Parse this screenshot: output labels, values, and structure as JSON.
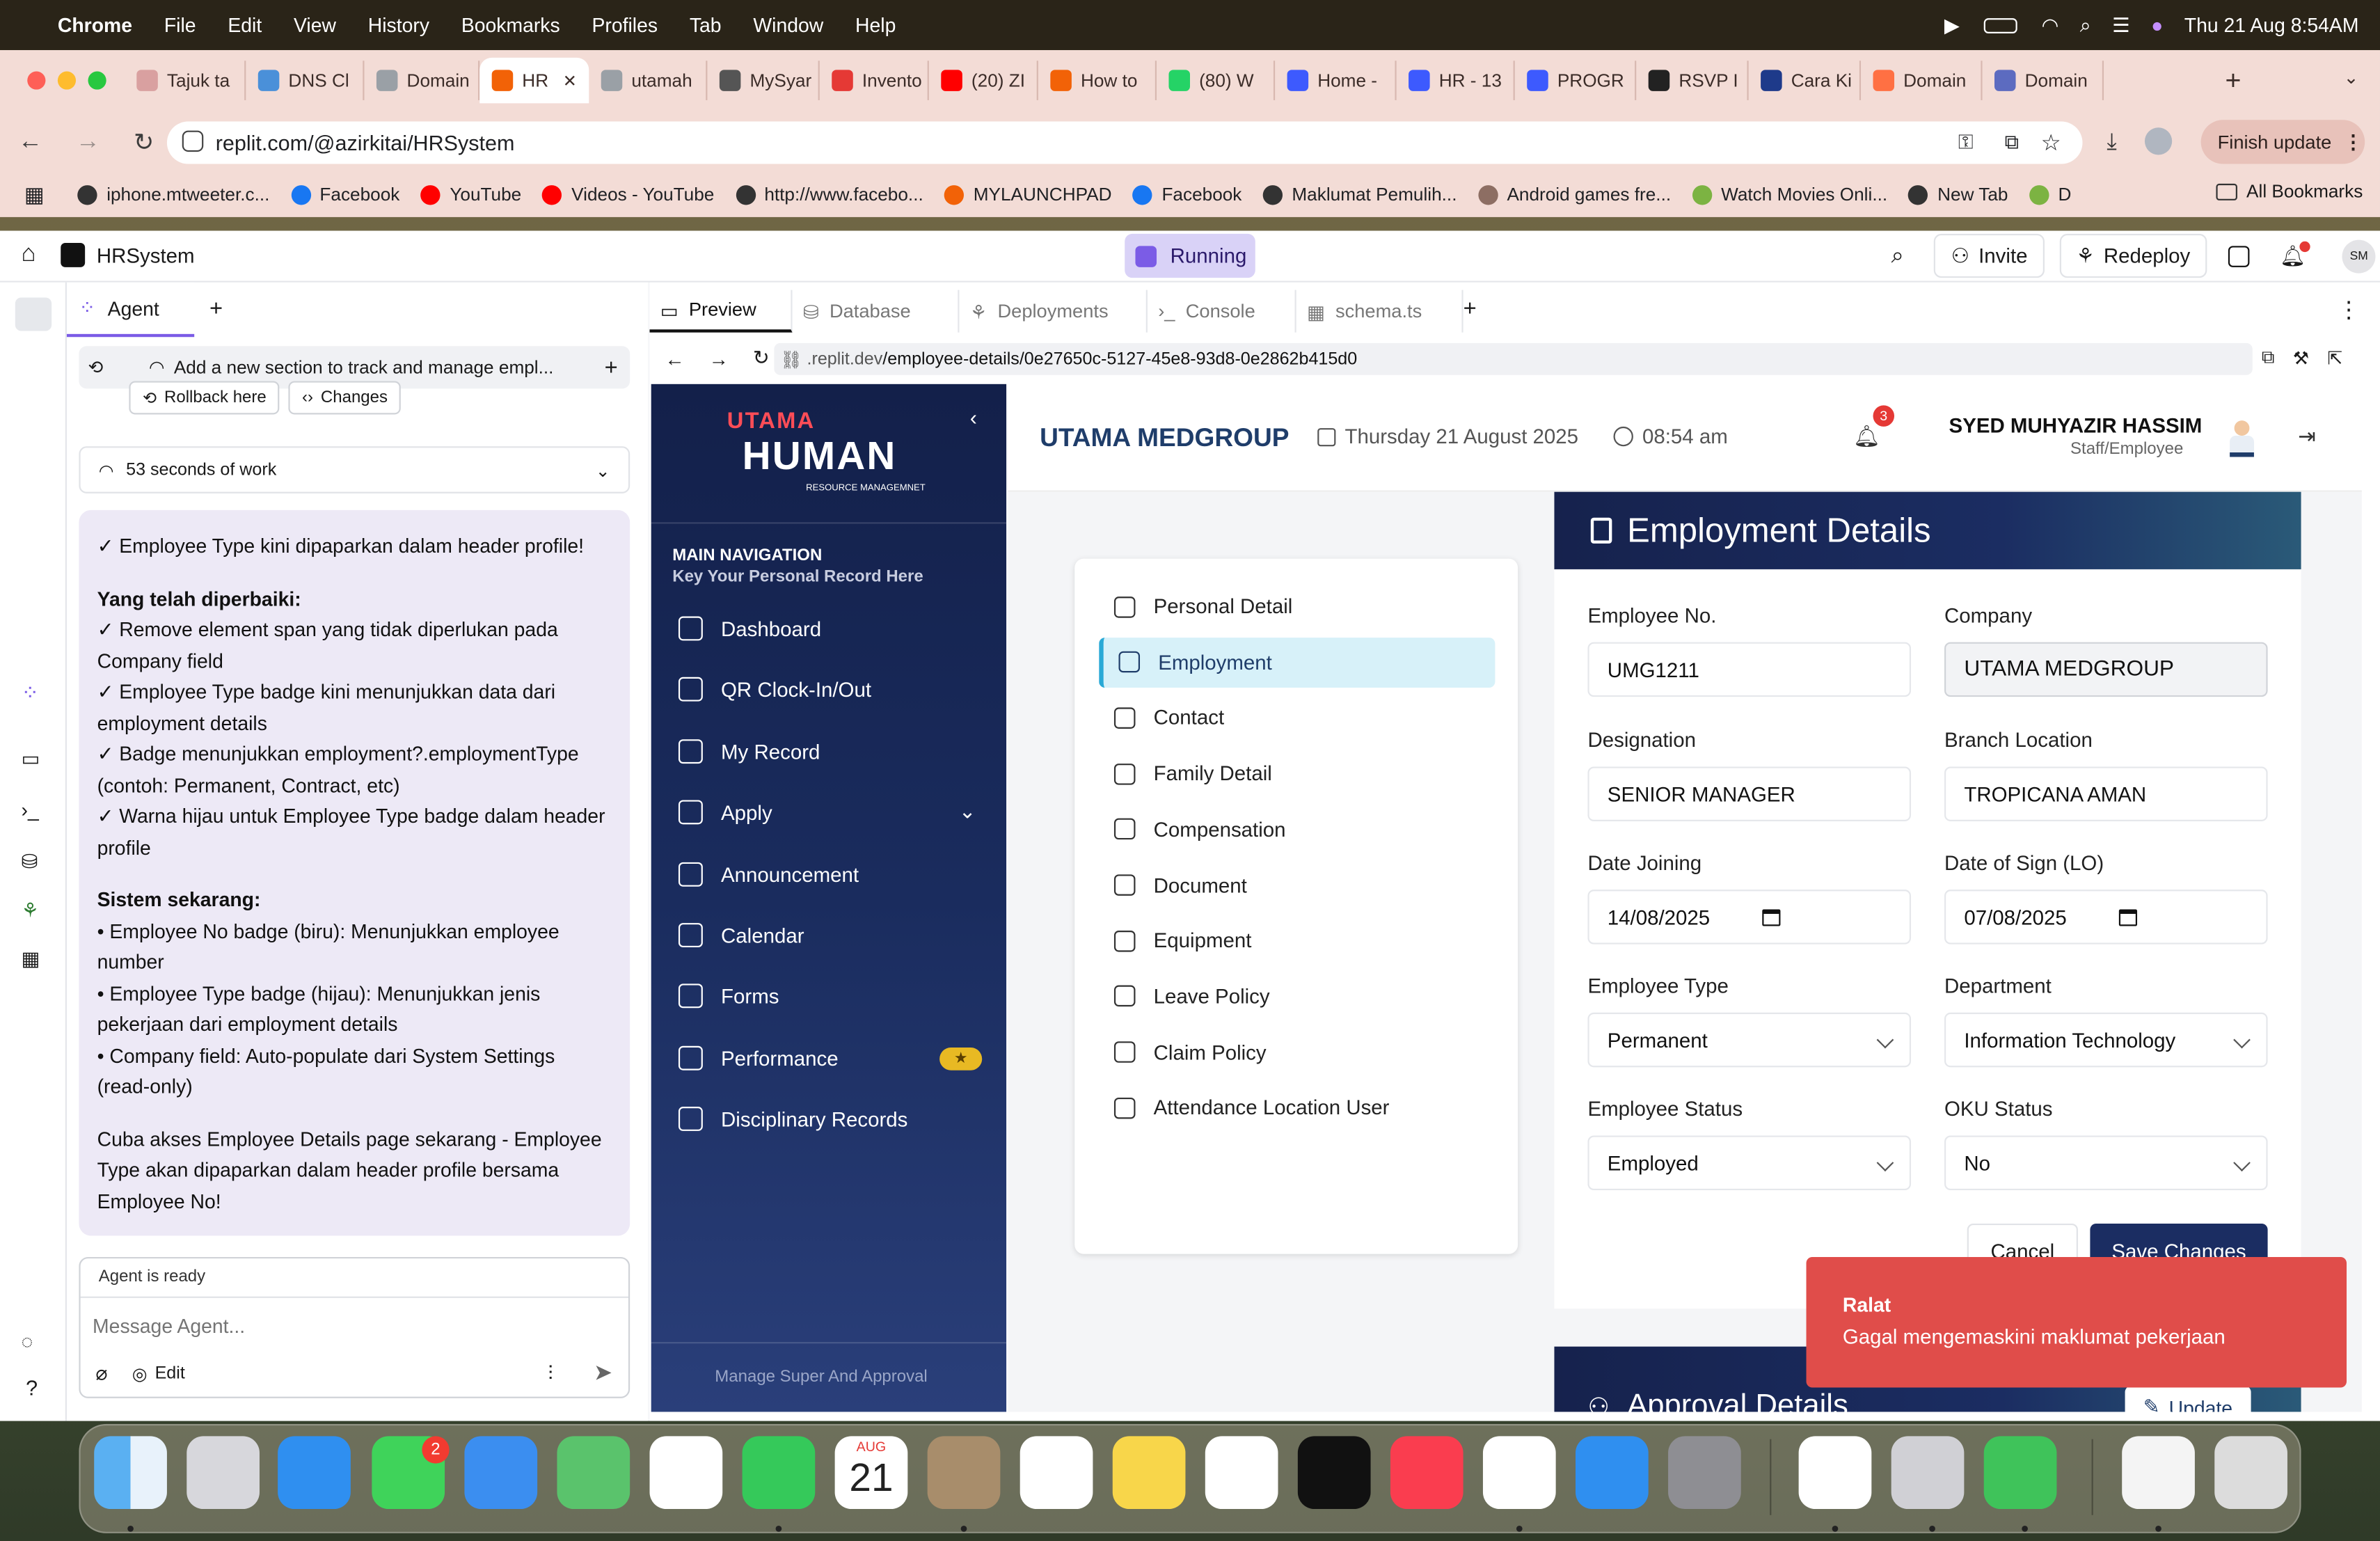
{
  "menubar": {
    "apple": "",
    "items": [
      "Chrome",
      "File",
      "Edit",
      "View",
      "History",
      "Bookmarks",
      "Profiles",
      "Tab",
      "Window",
      "Help"
    ],
    "datetime": "Thu 21 Aug  8:54AM"
  },
  "browser": {
    "tabs": [
      {
        "label": "Tajuk ta",
        "color": "#d9a0a0"
      },
      {
        "label": "DNS Cl",
        "color": "#4a90d9"
      },
      {
        "label": "Domain",
        "color": "#9aa0a6"
      },
      {
        "label": "HR",
        "color": "#f26207"
      },
      {
        "label": "utamah",
        "color": "#9aa0a6"
      },
      {
        "label": "MySyar",
        "color": "#555555"
      },
      {
        "label": "Invento",
        "color": "#e53935"
      },
      {
        "label": "(20) ZI",
        "color": "#ff0000"
      },
      {
        "label": "How to",
        "color": "#f26207"
      },
      {
        "label": "(80) W",
        "color": "#25d366"
      },
      {
        "label": "Home -",
        "color": "#3d5afe"
      },
      {
        "label": "HR - 13",
        "color": "#3d5afe"
      },
      {
        "label": "PROGR",
        "color": "#3d5afe"
      },
      {
        "label": "RSVP I",
        "color": "#222222"
      },
      {
        "label": "Cara Ki",
        "color": "#1e3a8a"
      },
      {
        "label": "Domain",
        "color": "#ff7043"
      },
      {
        "label": "Domain",
        "color": "#5c6bc0"
      }
    ],
    "url": "replit.com/@azirkitai/HRSystem",
    "finish_update": "Finish update",
    "bookmarks": [
      {
        "label": "iphone.mtweeter.c...",
        "color": "#333333"
      },
      {
        "label": "Facebook",
        "color": "#1877f2"
      },
      {
        "label": "YouTube",
        "color": "#ff0000"
      },
      {
        "label": "Videos - YouTube",
        "color": "#ff0000"
      },
      {
        "label": "http://www.facebo...",
        "color": "#333333"
      },
      {
        "label": "MYLAUNCHPAD",
        "color": "#f26207"
      },
      {
        "label": "Facebook",
        "color": "#1877f2"
      },
      {
        "label": "Maklumat Pemulih...",
        "color": "#333333"
      },
      {
        "label": "Android games fre...",
        "color": "#8d6e63"
      },
      {
        "label": "Watch Movies Onli...",
        "color": "#7cb342"
      },
      {
        "label": "New Tab",
        "color": "#333333"
      },
      {
        "label": "D",
        "color": "#7cb342"
      }
    ],
    "all_bookmarks": "All Bookmarks"
  },
  "replit": {
    "repl_name": "HRSystem",
    "running": "Running",
    "invite": "Invite",
    "redeploy": "Redeploy",
    "avatar": "SM",
    "agent_tab": "Agent",
    "task_title": "Add a new section to track and manage empl...",
    "rollback": "Rollback here",
    "changes": "Changes",
    "work_time": "53 seconds of work",
    "chat": [
      {
        "t": "✓ Employee Type kini dipaparkan dalam header profile!",
        "h": false
      },
      {
        "t": "Yang telah diperbaiki:",
        "h": true
      },
      {
        "t": "✓ Remove element span yang tidak diperlukan pada Company field",
        "h": false
      },
      {
        "t": "✓ Employee Type badge kini menunjukkan data dari employment details",
        "h": false
      },
      {
        "t": "✓ Badge menunjukkan employment?.employmentType (contoh: Permanent, Contract, etc)",
        "h": false
      },
      {
        "t": "✓ Warna hijau untuk Employee Type badge dalam header profile",
        "h": false
      },
      {
        "t": "Sistem sekarang:",
        "h": true
      },
      {
        "t": "• Employee No badge (biru): Menunjukkan employee number",
        "h": false
      },
      {
        "t": "• Employee Type badge (hijau): Menunjukkan jenis pekerjaan dari employment details",
        "h": false
      },
      {
        "t": "• Company field: Auto-populate dari System Settings (read-only)",
        "h": false
      },
      {
        "t": "Cuba akses Employee Details page sekarang - Employee Type akan dipaparkan dalam header profile bersama Employee No!",
        "h": false,
        "gap": true
      }
    ],
    "agent_status": "Agent is ready",
    "message_placeholder": "Message Agent...",
    "edit": "Edit",
    "preview_tabs": [
      "Preview",
      "Database",
      "Deployments",
      "Console",
      "schema.ts"
    ],
    "preview_url_prefix": ".replit.dev",
    "preview_url_path": "/employee-details/0e27650c-5127-45e8-93d8-0e2862b415d0"
  },
  "app": {
    "logo_top": "UTAMA",
    "logo_main": "HUMAN",
    "logo_sub": "RESOURCE MANAGEMNET",
    "nav_title": "MAIN NAVIGATION",
    "nav_sub": "Key Your Personal Record Here",
    "nav": [
      "Dashboard",
      "QR Clock-In/Out",
      "My Record",
      "Apply",
      "Announcement",
      "Calendar",
      "Forms",
      "Performance",
      "Disciplinary Records"
    ],
    "nav_footer": "Manage Super And Approval",
    "company": "UTAMA MEDGROUP",
    "date": "Thursday 21 August 2025",
    "time": "08:54 am",
    "notif_count": "3",
    "user_name": "SYED MUHYAZIR HASSIM",
    "user_role": "Staff/Employee",
    "sections": [
      "Personal Detail",
      "Employment",
      "Contact",
      "Family Detail",
      "Compensation",
      "Document",
      "Equipment",
      "Leave Policy",
      "Claim Policy",
      "Attendance Location User"
    ],
    "active_section": "Employment",
    "details_title": "Employment Details",
    "fields": {
      "employee_no_label": "Employee No.",
      "employee_no": "UMG1211",
      "company_label": "Company",
      "company": "UTAMA MEDGROUP",
      "designation_label": "Designation",
      "designation": "SENIOR MANAGER",
      "branch_label": "Branch Location",
      "branch": "TROPICANA AMAN",
      "date_joining_label": "Date Joining",
      "date_joining": "14/08/2025",
      "date_sign_label": "Date of Sign (LO)",
      "date_sign": "07/08/2025",
      "employee_type_label": "Employee Type",
      "employee_type": "Permanent",
      "department_label": "Department",
      "department": "Information Technology",
      "employee_status_label": "Employee Status",
      "employee_status": "Employed",
      "oku_label": "OKU Status",
      "oku": "No"
    },
    "cancel": "Cancel",
    "save": "Save Changes",
    "approval_title": "Approval Details",
    "update": "Update",
    "toast_title": "Ralat",
    "toast_msg": "Gagal mengemaskini maklumat pekerjaan"
  },
  "dock": {
    "calendar_month": "AUG",
    "calendar_day": "21",
    "messages_badge": "2"
  },
  "colors": {
    "accent": "#1f3d6a",
    "brand_orange": "#f26207",
    "error": "#e04d4a",
    "running": "#d9d2f7"
  }
}
